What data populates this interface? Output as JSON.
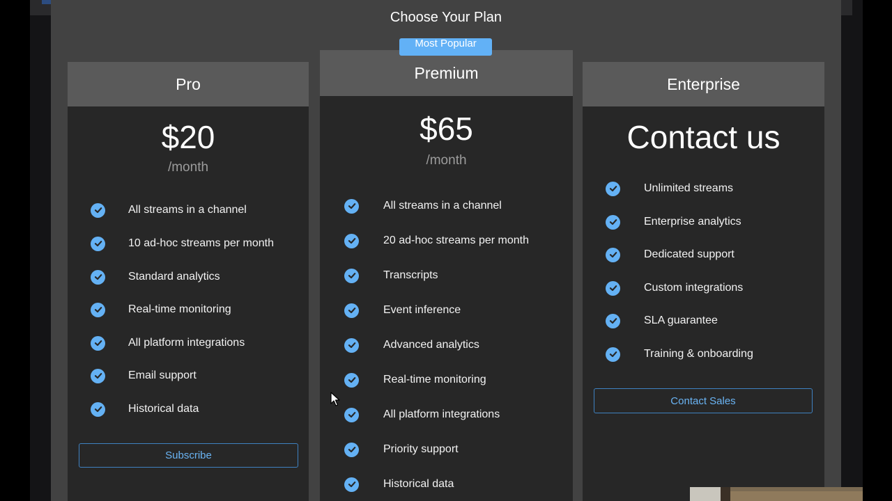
{
  "modal": {
    "title": "Choose Your Plan"
  },
  "badge": "Most Popular",
  "colors": {
    "accent": "#64b1f4",
    "card_bg": "#272727",
    "header_bg": "#5a5a5a",
    "modal_bg": "#424242"
  },
  "plans": [
    {
      "name": "Pro",
      "price": "$20",
      "period": "/month",
      "features": [
        "All streams in a channel",
        "10 ad-hoc streams per month",
        "Standard analytics",
        "Real-time monitoring",
        "All platform integrations",
        "Email support",
        "Historical data"
      ],
      "button": "Subscribe"
    },
    {
      "name": "Premium",
      "price": "$65",
      "period": "/month",
      "features": [
        "All streams in a channel",
        "20 ad-hoc streams per month",
        "Transcripts",
        "Event inference",
        "Advanced analytics",
        "Real-time monitoring",
        "All platform integrations",
        "Priority support",
        "Historical data"
      ]
    },
    {
      "name": "Enterprise",
      "price": "Contact us",
      "features": [
        "Unlimited streams",
        "Enterprise analytics",
        "Dedicated support",
        "Custom integrations",
        "SLA guarantee",
        "Training & onboarding"
      ],
      "button": "Contact Sales"
    }
  ],
  "icons": {
    "feature_check": "check-circle-icon",
    "pointer": "mouse-cursor-icon"
  }
}
